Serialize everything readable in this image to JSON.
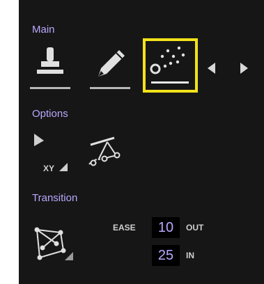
{
  "sections": {
    "main": "Main",
    "options": "Options",
    "transition": "Transition"
  },
  "main_tools": [
    {
      "icon": "stamp-icon"
    },
    {
      "icon": "pencil-icon"
    },
    {
      "icon": "spray-icon",
      "selected": true
    }
  ],
  "options": {
    "xy_label": "XY",
    "icons": [
      "cursor-icon",
      "curve-path-icon"
    ]
  },
  "transition": {
    "ease_label": "EASE",
    "ease_out_value": "10",
    "out_label": "OUT",
    "ease_in_value": "25",
    "in_label": "IN",
    "icon": "transition-shape-icon"
  },
  "colors": {
    "background": "#161616",
    "section_label": "#b9a8ff",
    "selection": "#f2e21a",
    "icon": "#e0e0e0"
  }
}
